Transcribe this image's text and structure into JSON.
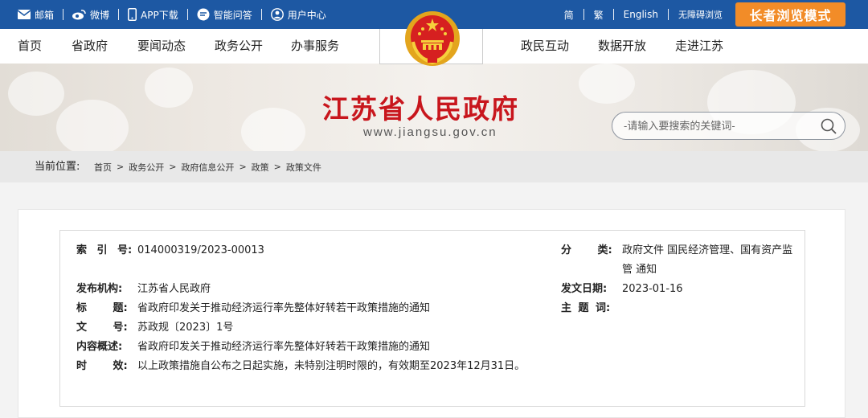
{
  "topbar": {
    "left_links": [
      {
        "label": "邮箱",
        "icon": "mail-icon"
      },
      {
        "label": "微博",
        "icon": "weibo-icon"
      },
      {
        "label": "APP下载",
        "icon": "phone-icon"
      },
      {
        "label": "智能问答",
        "icon": "chat-icon"
      },
      {
        "label": "用户中心",
        "icon": "user-icon"
      }
    ],
    "right_links": [
      "简",
      "繁",
      "English",
      "无障碍浏览"
    ],
    "elder_mode": "长者浏览模式"
  },
  "nav": {
    "left": [
      "首页",
      "省政府",
      "要闻动态",
      "政务公开",
      "办事服务"
    ],
    "right": [
      "政民互动",
      "数据开放",
      "走进江苏"
    ]
  },
  "banner": {
    "title": "江苏省人民政府",
    "url": "www.jiangsu.gov.cn",
    "search_placeholder": "-请输入要搜索的关键词-"
  },
  "breadcrumb": {
    "label": "当前位置:",
    "items": [
      "首页",
      "政务公开",
      "政府信息公开",
      "政策",
      "政策文件"
    ]
  },
  "info": {
    "index_label": "索 引 号:",
    "index_value": "014000319/2023-00013",
    "category_label": "分 类:",
    "category_value_1": "政府文件 国民经济管理、国有资产监",
    "category_value_2": "管 通知",
    "publisher_label": "发布机构:",
    "publisher_value": "江苏省人民政府",
    "date_label": "发文日期:",
    "date_value": "2023-01-16",
    "title_label": "标 题:",
    "title_value": "省政府印发关于推动经济运行率先整体好转若干政策措施的通知",
    "topic_label": "主 题 词:",
    "topic_value": "",
    "docno_label": "文 号:",
    "docno_value": "苏政规〔2023〕1号",
    "summary_label": "内容概述:",
    "summary_value": "省政府印发关于推动经济运行率先整体好转若干政策措施的通知",
    "validity_label": "时 效:",
    "validity_value": "以上政策措施自公布之日起实施，未特别注明时限的，有效期至2023年12月31日。"
  },
  "colors": {
    "topbar": "#1d58a3",
    "elder_btn": "#f28c28",
    "title_red": "#c8161d"
  }
}
